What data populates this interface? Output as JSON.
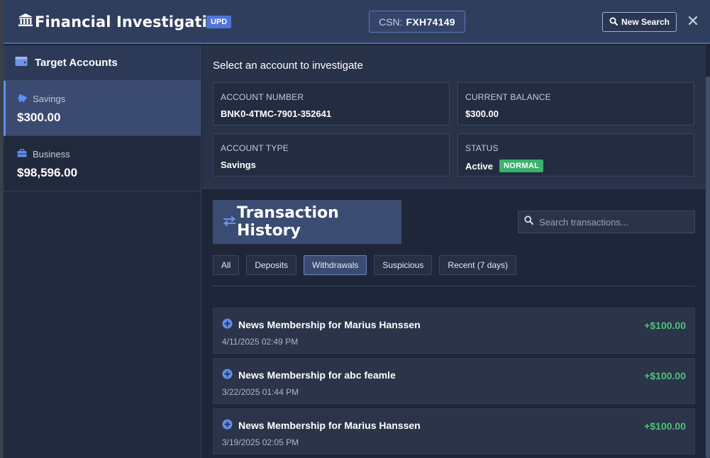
{
  "header": {
    "title": "Financial Investigation",
    "badge": "UPD",
    "csn_label": "CSN:",
    "csn_value": "FXH74149",
    "new_search_label": "New Search",
    "close_glyph": "✕"
  },
  "sidebar": {
    "title": "Target Accounts",
    "accounts": [
      {
        "type": "Savings",
        "balance": "$300.00",
        "icon": "piggy-bank-icon",
        "active": true
      },
      {
        "type": "Business",
        "balance": "$98,596.00",
        "icon": "briefcase-icon",
        "active": false
      }
    ]
  },
  "account_info": {
    "prompt": "Select an account to investigate",
    "account_number_label": "ACCOUNT NUMBER",
    "account_number": "BNK0-4TMC-7901-352641",
    "balance_label": "CURRENT BALANCE",
    "balance": "$300.00",
    "type_label": "ACCOUNT TYPE",
    "type": "Savings",
    "status_label": "STATUS",
    "status": "Active",
    "status_badge": "NORMAL"
  },
  "transactions": {
    "title": "Transaction History",
    "search_placeholder": "Search transactions...",
    "filters": [
      "All",
      "Deposits",
      "Withdrawals",
      "Suspicious",
      "Recent (7 days)"
    ],
    "active_filter": "Withdrawals",
    "items": [
      {
        "description": "News Membership for Marius Hanssen",
        "date": "4/11/2025 02:49 PM",
        "amount": "+$100.00"
      },
      {
        "description": "News Membership for abc feamle",
        "date": "3/22/2025 01:44 PM",
        "amount": "+$100.00"
      },
      {
        "description": "News Membership for Marius Hanssen",
        "date": "3/19/2025 02:05 PM",
        "amount": "+$100.00"
      }
    ]
  },
  "colors": {
    "accent": "#4e74d6",
    "positive_amount": "#4cc27c",
    "status_normal": "#3bb26c"
  }
}
